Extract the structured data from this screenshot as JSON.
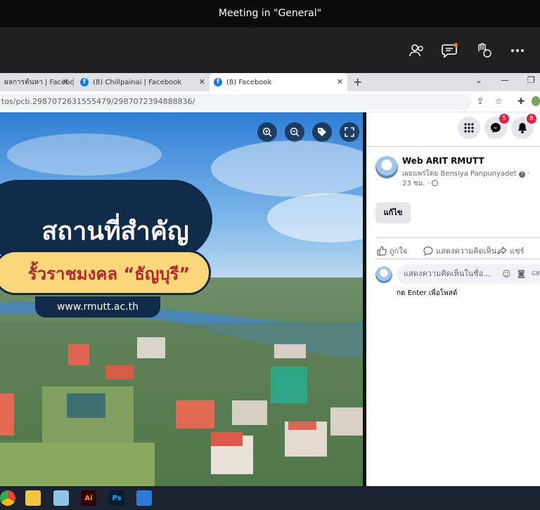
{
  "teams": {
    "title": "Meeting in \"General\"",
    "toolbar_icons": [
      "people-icon",
      "chat-icon",
      "raise-hand-icon",
      "more-icon"
    ]
  },
  "browser": {
    "tabs": [
      {
        "label": "ผลการค้นหา | Facebo"
      },
      {
        "label": "(8) Chillpainai | Facebook"
      },
      {
        "label": "(8) Facebook",
        "active": true
      }
    ],
    "url": "tos/pcb.2987072631555479/2987072394888836/"
  },
  "photo": {
    "title_thai": "สถานที่สำคัญ",
    "subtitle_thai": "รั้วราชมงคล “ธัญบุรี”",
    "website": "www.rmutt.ac.th"
  },
  "facebook": {
    "messenger_badge": "5",
    "notifications_badge": "8",
    "page_name": "Web ARIT RMUTT",
    "published_by": "เผยแพร่โดย Bensiya Panpunyadet",
    "time": "23 ชม.",
    "edit_label": "แก้ไข",
    "like_label": "ถูกใจ",
    "comment_label": "แสดงความคิดเห็น",
    "share_label": "แชร์",
    "comment_placeholder": "แสดงความคิดเห็นในชื่อ...",
    "enter_hint": "กด Enter เพื่อโพสต์"
  },
  "taskbar": {
    "apps": [
      "chrome-icon",
      "file-explorer-icon",
      "notepad-icon",
      "illustrator-icon",
      "photoshop-icon",
      "photos-icon"
    ],
    "illustrator_label": "Ai",
    "photoshop_label": "Ps"
  }
}
